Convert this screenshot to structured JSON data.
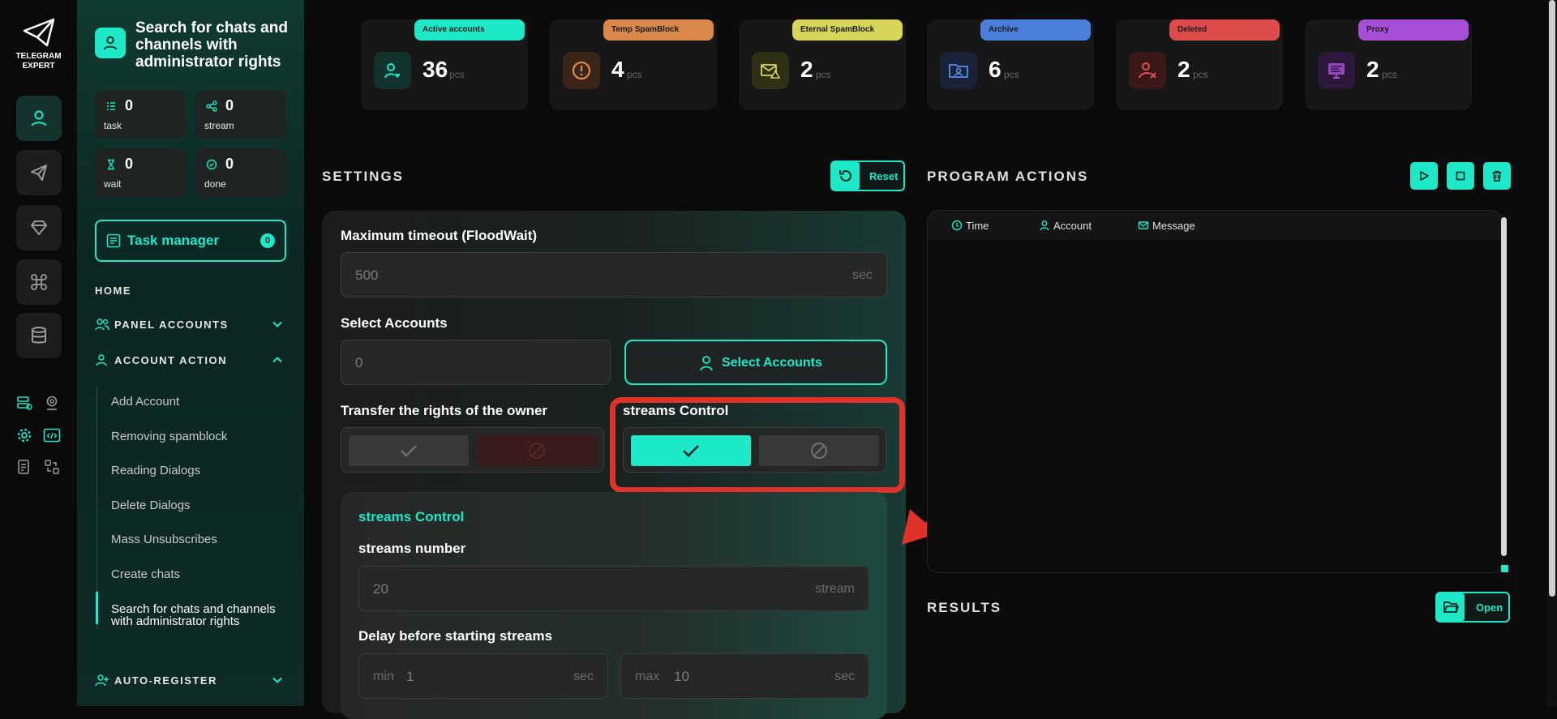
{
  "app": {
    "logo_line1": "TELEGRAM",
    "logo_line2": "EXPERT"
  },
  "rail": {
    "items": [
      "user-icon",
      "send-icon",
      "diamond-icon",
      "command-icon",
      "database-icon"
    ],
    "tools": [
      "server-icon",
      "location-pin-icon",
      "settings-gear-icon",
      "code-icon",
      "document-icon",
      "switch-icon"
    ]
  },
  "sidebar": {
    "title": "Search for chats and channels with administrator rights",
    "stats": [
      {
        "value": "0",
        "label": "task"
      },
      {
        "value": "0",
        "label": "stream"
      },
      {
        "value": "0",
        "label": "wait"
      },
      {
        "value": "0",
        "label": "done"
      }
    ],
    "task_manager": {
      "label": "Task manager",
      "count": "0"
    },
    "home": "HOME",
    "panel_accounts": "PANEL ACCOUNTS",
    "account_action": "ACCOUNT ACTION",
    "auto_register": "AUTO-REGISTER",
    "sub_items": [
      "Add Account",
      "Removing spamblock",
      "Reading Dialogs",
      "Delete Dialogs",
      "Mass Unsubscribes",
      "Create chats",
      "Search for chats and channels with administrator rights"
    ]
  },
  "top_cards": [
    {
      "tag": "Active accounts",
      "value": "36",
      "unit": "pcs",
      "color": "#1de9c8"
    },
    {
      "tag": "Temp SpamBlock",
      "value": "4",
      "unit": "pcs",
      "color": "#d9874a"
    },
    {
      "tag": "Eternal SpamBlock",
      "value": "2",
      "unit": "pcs",
      "color": "#d8d65a"
    },
    {
      "tag": "Archive",
      "value": "6",
      "unit": "pcs",
      "color": "#4b7fdb"
    },
    {
      "tag": "Deleted",
      "value": "2",
      "unit": "pcs",
      "color": "#dd4b4b"
    },
    {
      "tag": "Proxy",
      "value": "2",
      "unit": "pcs",
      "color": "#a74fd6"
    }
  ],
  "settings": {
    "title": "SETTINGS",
    "reset_label": "Reset",
    "timeout": {
      "label": "Maximum timeout (FloodWait)",
      "value": "500",
      "unit": "sec"
    },
    "accounts": {
      "label": "Select Accounts",
      "value": "0",
      "button": "Select Accounts"
    },
    "transfer": {
      "label": "Transfer the rights of the owner"
    },
    "streams_toggle": {
      "label": "streams Control"
    },
    "streams": {
      "title": "streams Control",
      "number_label": "streams number",
      "number_value": "20",
      "number_unit": "stream",
      "delay_label": "Delay before starting streams",
      "min_prefix": "min",
      "min_value": "1",
      "max_prefix": "max",
      "max_value": "10",
      "unit": "sec"
    }
  },
  "program_actions": {
    "title": "PROGRAM ACTIONS",
    "columns": [
      "Time",
      "Account",
      "Message"
    ]
  },
  "results": {
    "title": "RESULTS",
    "open_label": "Open"
  },
  "colors": {
    "accent": "#1de9c8",
    "highlight": "#e0312b"
  }
}
